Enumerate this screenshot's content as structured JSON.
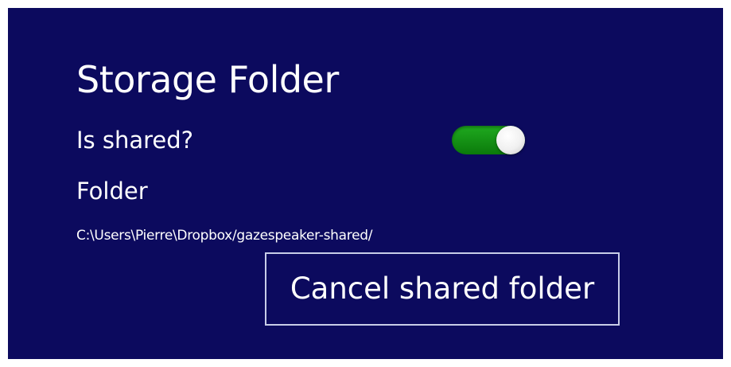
{
  "page": {
    "title": "Storage Folder",
    "shared_label": "Is shared?",
    "shared_value": true,
    "folder_label": "Folder",
    "folder_path": "C:\\Users\\Pierre\\Dropbox/gazespeaker-shared/",
    "cancel_button_label": "Cancel shared folder"
  },
  "colors": {
    "background": "#0c0a5e",
    "text": "#ffffff",
    "toggle_on": "#128f12",
    "button_border": "#c8cde8"
  }
}
